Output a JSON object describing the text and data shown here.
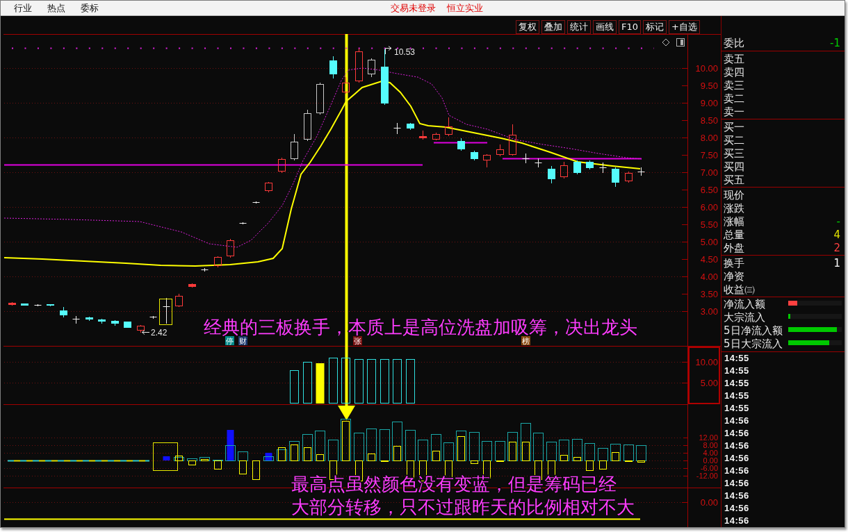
{
  "top_bar": {
    "menu": [
      {
        "label": "行业"
      },
      {
        "label": "热点"
      },
      {
        "label": "委标"
      }
    ],
    "login_status": "交易未登录",
    "stock_name": "恒立实业"
  },
  "toolbar": [
    {
      "label": "复权"
    },
    {
      "label": "叠加"
    },
    {
      "label": "统计"
    },
    {
      "label": "画线"
    },
    {
      "label": "F10"
    },
    {
      "label": "标记"
    },
    {
      "label": "+自选"
    }
  ],
  "price_chart": {
    "axis_labels": [
      "10.00",
      "9.50",
      "9.00",
      "8.50",
      "8.00",
      "7.50",
      "7.00",
      "6.50",
      "6.00",
      "5.50",
      "5.00",
      "4.50",
      "4.00",
      "3.50",
      "3.00"
    ],
    "high_label": "10.53",
    "low_label": "2.42",
    "markers": [
      {
        "text": "停",
        "color": "#008a8a"
      },
      {
        "text": "财",
        "color": "#1c3a6e"
      },
      {
        "text": "张",
        "color": "#7a1010"
      },
      {
        "text": "榜",
        "color": "#8a4a10"
      }
    ],
    "annotation": "经典的三板换手，本质上是高位洗盘加吸筹，决出龙头"
  },
  "volume_pane": {
    "axis_labels": [
      "10.00",
      "5.00"
    ]
  },
  "indicator_pane": {
    "axis_labels": [
      "12.00",
      "8.00",
      "4.00",
      "0.00",
      "-6.00",
      "-12.00"
    ],
    "annotation": [
      "最高点虽然颜色没有变蓝，但是筹码已经",
      "大部分转移，只不过跟昨天的比例相对不大"
    ]
  },
  "bottom_pane": {
    "axis_labels": [
      "0.00"
    ]
  },
  "quote_panel": {
    "ratio": {
      "label": "委比",
      "value": "-1",
      "color": "#00d000"
    },
    "asks": [
      {
        "label": "卖五"
      },
      {
        "label": "卖四"
      },
      {
        "label": "卖三"
      },
      {
        "label": "卖二"
      },
      {
        "label": "卖一"
      }
    ],
    "bids": [
      {
        "label": "买一"
      },
      {
        "label": "买二"
      },
      {
        "label": "买三"
      },
      {
        "label": "买四"
      },
      {
        "label": "买五"
      }
    ],
    "stats": [
      {
        "label": "现价"
      },
      {
        "label": "涨跌"
      },
      {
        "label": "涨幅",
        "value": "-",
        "color": "#00d000"
      },
      {
        "label": "总量",
        "value": "4",
        "color": "#e0e000"
      },
      {
        "label": "外盘",
        "value": "2",
        "color": "#ff4040"
      }
    ],
    "extras": [
      {
        "label": "换手",
        "value": "1",
        "color": "#ffffff"
      },
      {
        "label": "净资"
      },
      {
        "label": "收益㈢"
      }
    ],
    "flows": [
      {
        "label": "净流入额",
        "level": 0.17,
        "color": "#ff4040"
      },
      {
        "label": "大宗流入",
        "level": 0.04,
        "color": "#00c800"
      },
      {
        "label": "5日净流入额",
        "level": 0.91,
        "color": "#00c800"
      },
      {
        "label": "5日大宗流入",
        "level": 0.77,
        "color": "#00c800"
      }
    ]
  },
  "trades": [
    {
      "time": "14:55"
    },
    {
      "time": "14:55"
    },
    {
      "time": "14:55"
    },
    {
      "time": "14:55"
    },
    {
      "time": "14:55"
    },
    {
      "time": "14:56"
    },
    {
      "time": "14:56"
    },
    {
      "time": "14:56"
    },
    {
      "time": "14:56"
    },
    {
      "time": "14:56"
    },
    {
      "time": "14:56"
    },
    {
      "time": "14:56"
    },
    {
      "time": "14:56"
    },
    {
      "time": "14:56"
    }
  ]
}
